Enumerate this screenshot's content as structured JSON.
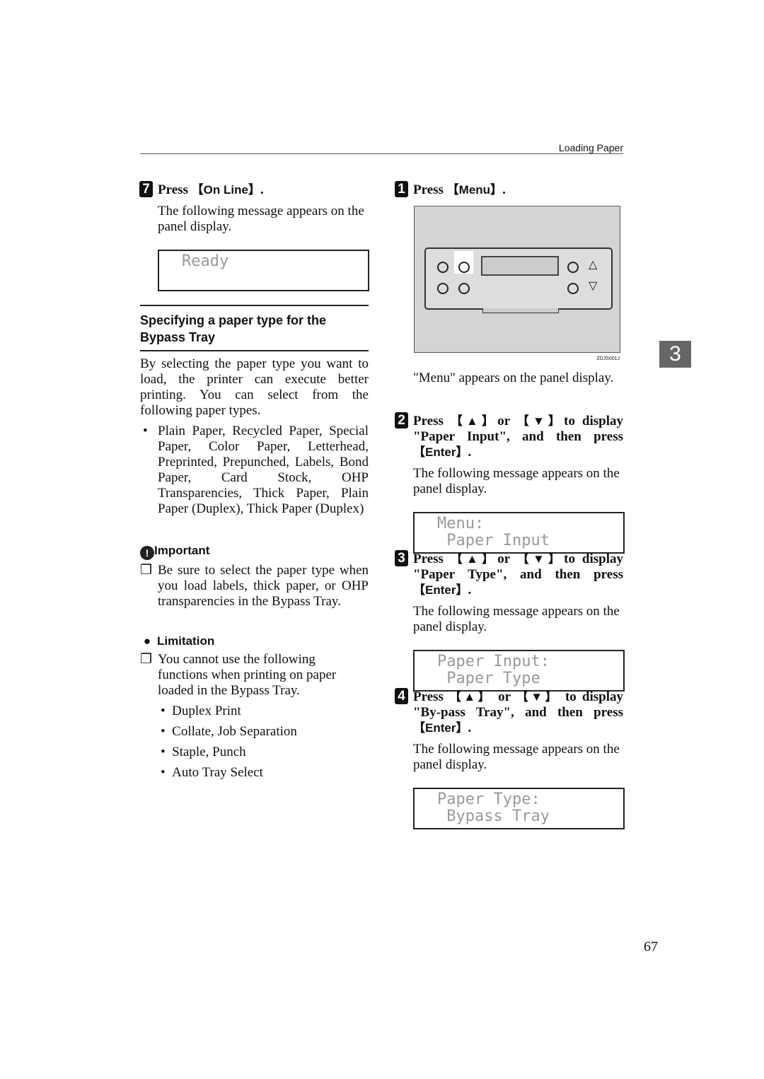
{
  "header": {
    "title": "Loading Paper"
  },
  "left": {
    "step7": {
      "num": "7",
      "pre": "Press ",
      "key": "【On Line】",
      "post": ".",
      "text": "The following message appears on the panel display.",
      "lcd": "Ready"
    },
    "section_title": "Specifying a paper type for the Bypass Tray",
    "intro": "By selecting the paper type you want to load, the printer can execute better printing. You can select from the following paper types.",
    "types": "Plain Paper, Recycled Paper, Special Paper, Color Paper, Letterhead, Preprinted, Prepunched, Labels, Bond Paper, Card Stock, OHP Transparencies, Thick Paper, Plain Paper (Duplex), Thick Paper (Duplex)",
    "important": {
      "label": "Important",
      "text": "Be sure to select the paper type when you load labels, thick paper, or OHP transparencies in the Bypass Tray."
    },
    "limitation": {
      "label": "Limitation",
      "text": "You cannot use the following functions when printing on paper loaded in the Bypass Tray.",
      "items": [
        "Duplex Print",
        "Collate, Job Separation",
        "Staple, Punch",
        "Auto Tray Select"
      ]
    }
  },
  "right": {
    "step1": {
      "num": "1",
      "pre": "Press ",
      "key": "【Menu】",
      "post": ".",
      "figure_code": "ZDJS001J",
      "text": "\"Menu\" appears on the panel display."
    },
    "step2": {
      "num": "2",
      "a": "Press ",
      "k1": "【▲】",
      "b": "or ",
      "k2": "【▼】",
      "c": "to display \"Paper Input\", and then press ",
      "k3": "【Enter】",
      "d": ".",
      "text": "The following message appears on the panel display.",
      "lcd": "Menu:\n Paper Input"
    },
    "step3": {
      "num": "3",
      "a": "Press ",
      "k1": "【▲】",
      "b": "or ",
      "k2": "【▼】",
      "c": "to display \"Paper Type\", and then press ",
      "k3": "【Enter】",
      "d": ".",
      "text": "The following message appears on the panel display.",
      "lcd": "Paper Input:\n Paper Type"
    },
    "step4": {
      "num": "4",
      "a": "Press ",
      "k1": "【▲】",
      "b": " or ",
      "k2": "【▼】",
      "c": " to display \"By-pass Tray\", and then press ",
      "k3": "【Enter】",
      "d": ".",
      "text": "The following message appears on the panel display.",
      "lcd": "Paper Type:\n Bypass Tray"
    }
  },
  "chapter_tab": "3",
  "page_number": "67"
}
